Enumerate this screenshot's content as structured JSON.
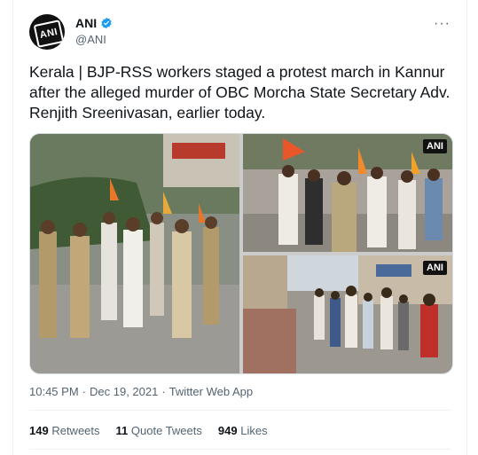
{
  "author": {
    "name": "ANI",
    "handle": "@ANI",
    "avatar_text": "ANI",
    "verified_icon": "verified-badge-icon"
  },
  "more_label": "···",
  "tweet": {
    "text": "Kerala | BJP-RSS workers staged a protest march in Kannur after the alleged murder of OBC Morcha State Secretary Adv. Renjith Sreenivasan, earlier today."
  },
  "media": {
    "watermark": "ANI"
  },
  "meta": {
    "time": "10:45 PM",
    "sep1": "·",
    "date": "Dec 19, 2021",
    "sep2": "·",
    "source": "Twitter Web App"
  },
  "stats": {
    "retweets_count": "149",
    "retweets_label": "Retweets",
    "quotes_count": "11",
    "quotes_label": "Quote Tweets",
    "likes_count": "949",
    "likes_label": "Likes"
  },
  "colors": {
    "accent": "#1d9bf0",
    "secondary_text": "#536471"
  }
}
